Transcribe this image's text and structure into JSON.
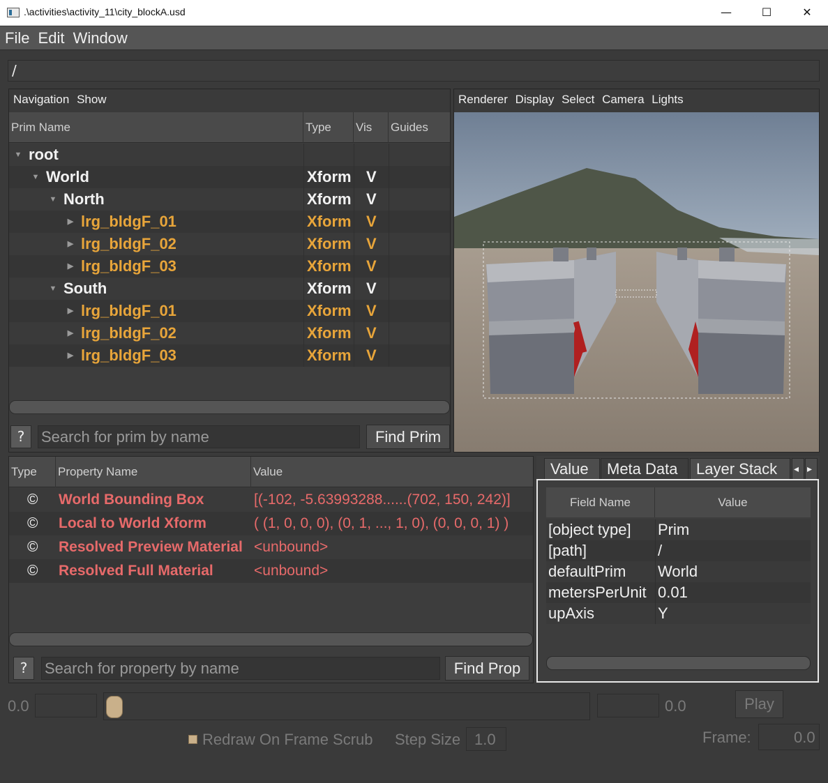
{
  "window": {
    "title": ".\\activities\\activity_11\\city_blockA.usd",
    "controls": {
      "minimize": "—",
      "maximize": "☐",
      "close": "✕"
    }
  },
  "menubar": {
    "items": [
      "File",
      "Edit",
      "Window"
    ]
  },
  "path": "/",
  "prim_browser": {
    "menu": [
      "Navigation",
      "Show"
    ],
    "columns": [
      "Prim Name",
      "Type",
      "Vis",
      "Guides"
    ],
    "rows": [
      {
        "name": "root",
        "type": "",
        "vis": "",
        "depth": 0,
        "expanded": true,
        "color": "white"
      },
      {
        "name": "World",
        "type": "Xform",
        "vis": "V",
        "depth": 1,
        "expanded": true,
        "color": "white"
      },
      {
        "name": "North",
        "type": "Xform",
        "vis": "V",
        "depth": 2,
        "expanded": true,
        "color": "white"
      },
      {
        "name": "lrg_bldgF_01",
        "type": "Xform",
        "vis": "V",
        "depth": 3,
        "expanded": false,
        "color": "orange"
      },
      {
        "name": "lrg_bldgF_02",
        "type": "Xform",
        "vis": "V",
        "depth": 3,
        "expanded": false,
        "color": "orange"
      },
      {
        "name": "lrg_bldgF_03",
        "type": "Xform",
        "vis": "V",
        "depth": 3,
        "expanded": false,
        "color": "orange"
      },
      {
        "name": "South",
        "type": "Xform",
        "vis": "V",
        "depth": 2,
        "expanded": true,
        "color": "white"
      },
      {
        "name": "lrg_bldgF_01",
        "type": "Xform",
        "vis": "V",
        "depth": 3,
        "expanded": false,
        "color": "orange"
      },
      {
        "name": "lrg_bldgF_02",
        "type": "Xform",
        "vis": "V",
        "depth": 3,
        "expanded": false,
        "color": "orange"
      },
      {
        "name": "lrg_bldgF_03",
        "type": "Xform",
        "vis": "V",
        "depth": 3,
        "expanded": false,
        "color": "orange"
      }
    ],
    "help_label": "?",
    "search_placeholder": "Search for prim by name",
    "find_label": "Find Prim"
  },
  "viewport": {
    "menu": [
      "Renderer",
      "Display",
      "Select",
      "Camera",
      "Lights"
    ]
  },
  "properties": {
    "columns": [
      "Type",
      "Property Name",
      "Value"
    ],
    "rows": [
      {
        "icon": "©",
        "name": "World Bounding Box",
        "value": "[(-102, -5.63993288......(702, 150, 242)]"
      },
      {
        "icon": "©",
        "name": "Local to World Xform",
        "value": "( (1, 0, 0, 0), (0, 1, ..., 1, 0), (0, 0, 0, 1) )"
      },
      {
        "icon": "©",
        "name": "Resolved Preview Material",
        "value": "<unbound>"
      },
      {
        "icon": "©",
        "name": "Resolved Full Material",
        "value": "<unbound>"
      }
    ],
    "help_label": "?",
    "search_placeholder": "Search for property by name",
    "find_label": "Find Prop"
  },
  "metadata": {
    "tabs": [
      "Value",
      "Meta Data",
      "Layer Stack"
    ],
    "active_tab": "Meta Data",
    "columns": [
      "Field Name",
      "Value"
    ],
    "rows": [
      {
        "field": "[object type]",
        "value": "Prim"
      },
      {
        "field": "[path]",
        "value": "/"
      },
      {
        "field": "defaultPrim",
        "value": "World"
      },
      {
        "field": "metersPerUnit",
        "value": "0.01"
      },
      {
        "field": "upAxis",
        "value": "Y"
      }
    ],
    "tab_scroll_left": "◂",
    "tab_scroll_right": "▸"
  },
  "timeline": {
    "start_label": "0.0",
    "end_label": "0.0",
    "play_label": "Play",
    "redraw_label": "Redraw On Frame Scrub",
    "step_size_label": "Step Size",
    "step_size_value": "1.0",
    "frame_label": "Frame:",
    "frame_value": "0.0"
  },
  "colors": {
    "window_bg": "#3a3a3a",
    "prim_default": "#f2f2f2",
    "prim_referenced": "#e8a53a",
    "property_computed": "#e76a6a",
    "slider_handle": "#c9b08a"
  }
}
